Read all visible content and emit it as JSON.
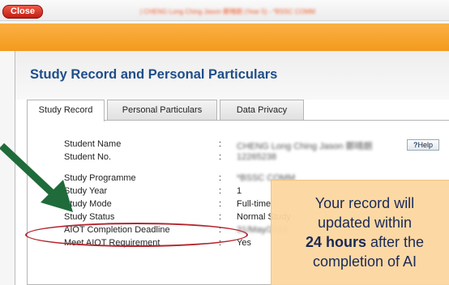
{
  "window": {
    "close_label": "Close",
    "title": "| CHENG Long Ching Jason 鄭晴朗 (Year 5) - *BSSC COMM"
  },
  "page": {
    "title": "Study Record and Personal Particulars"
  },
  "tabs": [
    {
      "label": "Study Record",
      "active": true
    },
    {
      "label": "Personal Particulars",
      "active": false
    },
    {
      "label": "Data Privacy",
      "active": false
    }
  ],
  "record": {
    "help_label": "Help",
    "fields": [
      {
        "label": "Student Name",
        "value": "CHENG Long Ching Jason 鄭晴朗"
      },
      {
        "label": "Student No.",
        "value": "12265238"
      },
      {
        "label": "Study Programme",
        "value": "*BSSC COMM"
      },
      {
        "label": "Study Year",
        "value": "1"
      },
      {
        "label": "Study Mode",
        "value": "Full-time"
      },
      {
        "label": "Study Status",
        "value": "Normal Study"
      },
      {
        "label": "AIOT Completion Deadline",
        "value": "31/May/2015"
      },
      {
        "label": "Meet AIOT Requirement",
        "value": "Yes"
      }
    ]
  },
  "annotation": {
    "line1": "Your record will",
    "line2": "updated within",
    "line3_bold": "24 hours",
    "line3_rest": "after the",
    "line4": "completion of AI"
  },
  "colors": {
    "accent_orange": "#f39a1e",
    "title_blue": "#1f4d8a",
    "close_red": "#d0291c",
    "arrow_green": "#1f6b3a",
    "highlight_oval": "#b3262f",
    "note_fill": "#fcd79e"
  }
}
